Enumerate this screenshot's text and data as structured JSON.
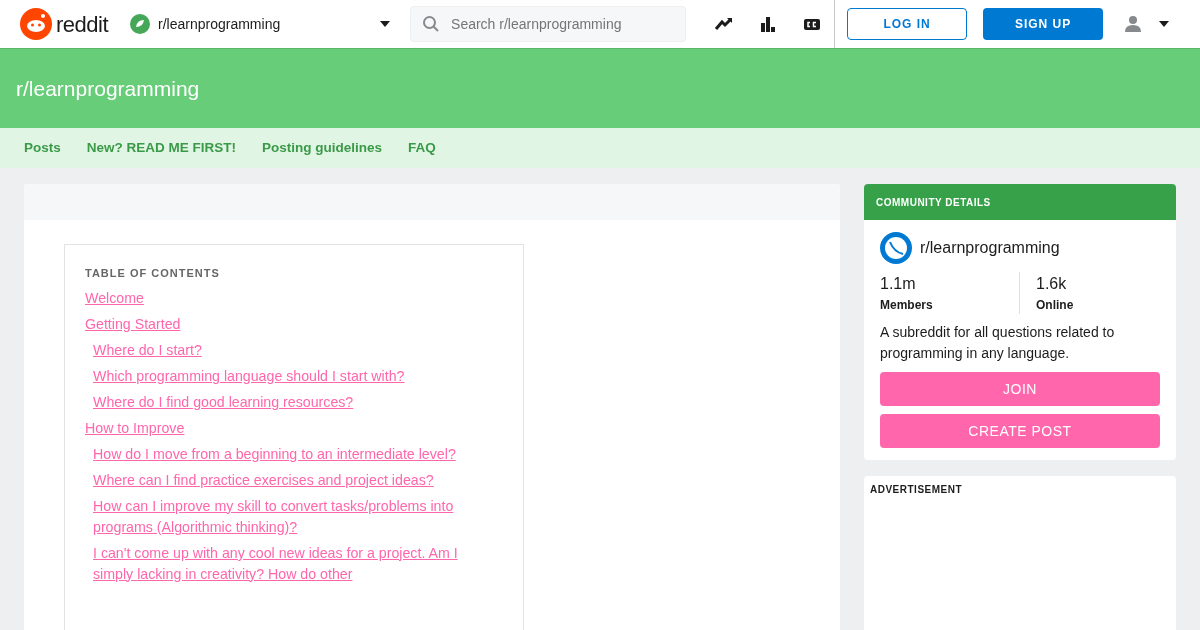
{
  "header": {
    "logo_text": "reddit",
    "community": "r/learnprogramming",
    "search": {
      "placeholder": "Search r/learnprogramming"
    },
    "login": "LOG IN",
    "signup": "SIGN UP"
  },
  "banner": {
    "title": "r/learnprogramming"
  },
  "subnav": [
    {
      "label": "Posts"
    },
    {
      "label": "New? READ ME FIRST!"
    },
    {
      "label": "Posting guidelines"
    },
    {
      "label": "FAQ"
    }
  ],
  "toc": {
    "title": "TABLE OF CONTENTS",
    "items": [
      {
        "label": "Welcome"
      },
      {
        "label": "Getting Started",
        "children": [
          {
            "label": "Where do I start?"
          },
          {
            "label": "Which programming language should I start with?"
          },
          {
            "label": "Where do I find good learning resources?"
          }
        ]
      },
      {
        "label": "How to Improve",
        "children": [
          {
            "label": "How do I move from a beginning to an intermediate level?"
          },
          {
            "label": "Where can I find practice exercises and project ideas?"
          },
          {
            "label": "How can I improve my skill to convert tasks/problems into programs (Algorithmic thinking)?"
          },
          {
            "label": "I can't come up with any cool new ideas for a project. Am I simply lacking in creativity? How do other"
          }
        ]
      }
    ]
  },
  "community": {
    "heading": "COMMUNITY DETAILS",
    "name": "r/learnprogramming",
    "members": "1.1m",
    "members_label": "Members",
    "online": "1.6k",
    "online_label": "Online",
    "description": "A subreddit for all questions related to programming in any language.",
    "join": "JOIN",
    "create_post": "CREATE POST"
  },
  "advertisement": {
    "label": "ADVERTISEMENT"
  }
}
